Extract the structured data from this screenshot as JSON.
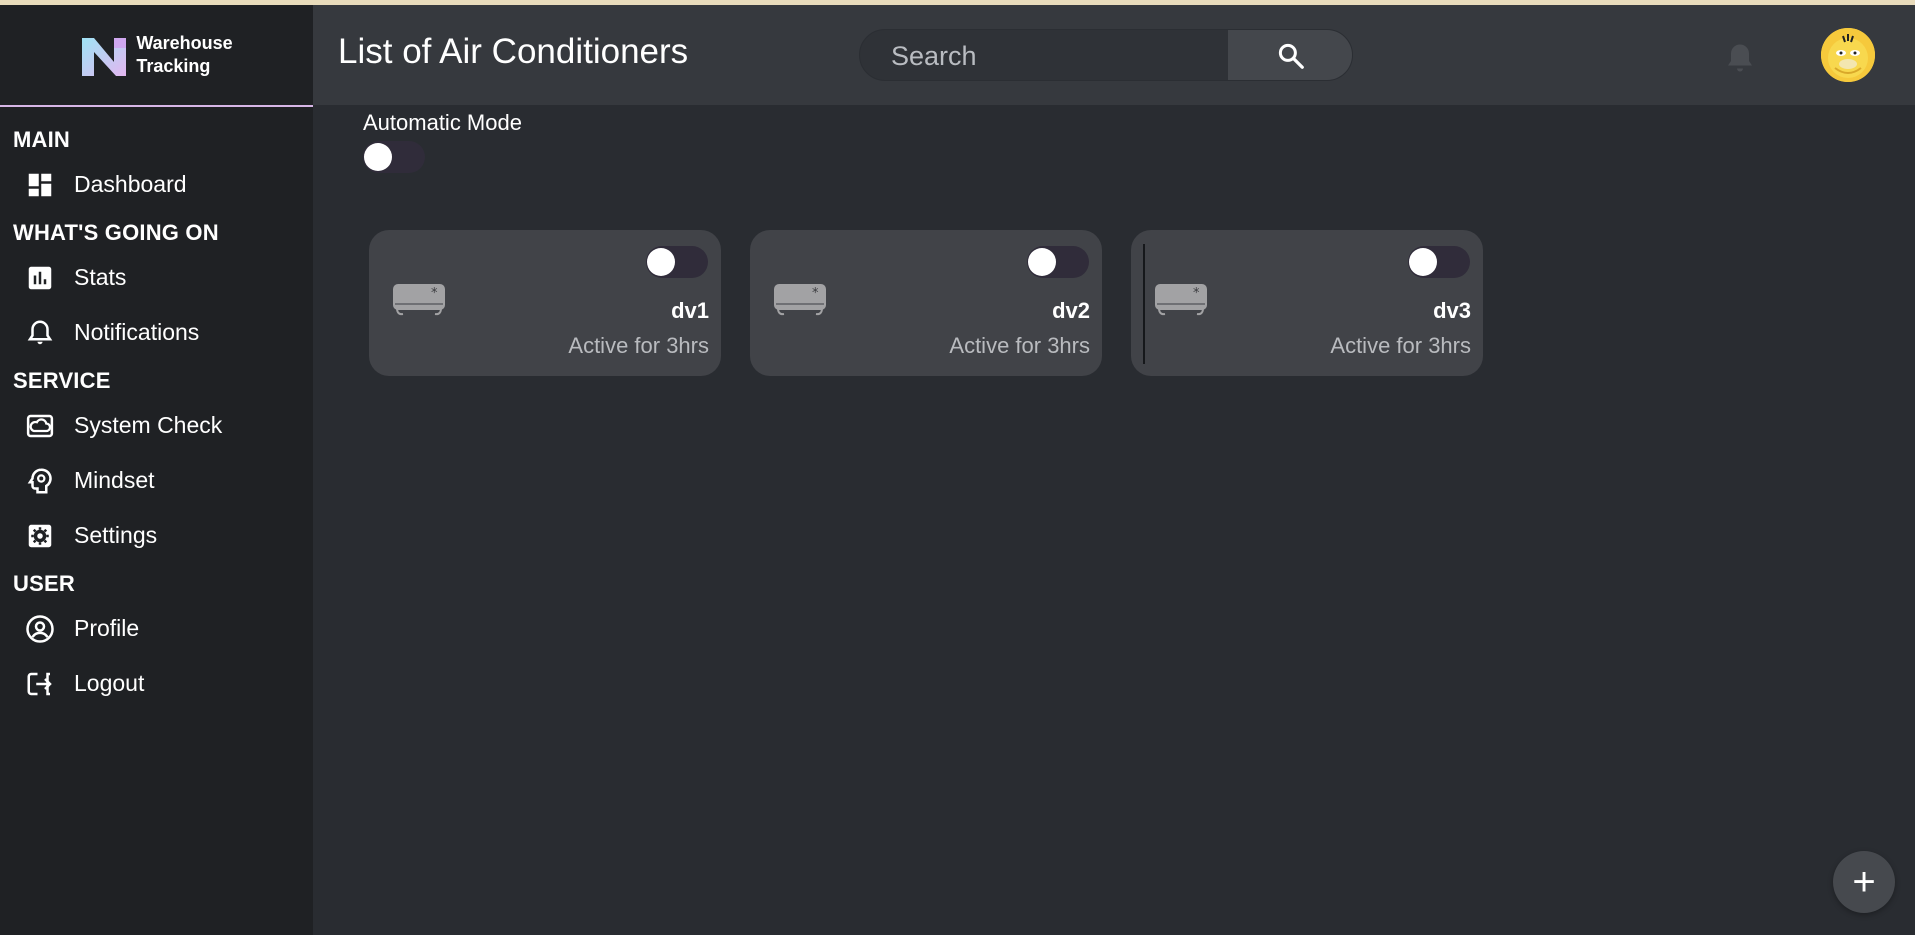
{
  "brand": {
    "name_line1": "Warehouse",
    "name_line2": "Tracking"
  },
  "sidebar": {
    "sections": [
      {
        "title": "MAIN",
        "items": [
          {
            "label": "Dashboard",
            "icon": "dashboard-icon"
          }
        ]
      },
      {
        "title": "WHAT'S GOING ON",
        "items": [
          {
            "label": "Stats",
            "icon": "stats-icon"
          },
          {
            "label": "Notifications",
            "icon": "bell-icon"
          }
        ]
      },
      {
        "title": "SERVICE",
        "items": [
          {
            "label": "System Check",
            "icon": "system-check-icon"
          },
          {
            "label": "Mindset",
            "icon": "mindset-icon"
          },
          {
            "label": "Settings",
            "icon": "gear-icon"
          }
        ]
      },
      {
        "title": "USER",
        "items": [
          {
            "label": "Profile",
            "icon": "profile-icon"
          },
          {
            "label": "Logout",
            "icon": "logout-icon"
          }
        ]
      }
    ]
  },
  "header": {
    "title": "List of Air Conditioners",
    "search_placeholder": "Search"
  },
  "main": {
    "automatic_mode_label": "Automatic Mode",
    "automatic_mode_on": false,
    "devices": [
      {
        "name": "dv1",
        "status": "Active for 3hrs",
        "on": false
      },
      {
        "name": "dv2",
        "status": "Active for 3hrs",
        "on": false
      },
      {
        "name": "dv3",
        "status": "Active for 3hrs",
        "on": false
      }
    ],
    "fab_symbol": "+"
  },
  "colors": {
    "background": "#292c31",
    "sidebar": "#1f2124",
    "header": "#36393e",
    "card": "#414348",
    "accent_line": "#d6b6e6"
  }
}
